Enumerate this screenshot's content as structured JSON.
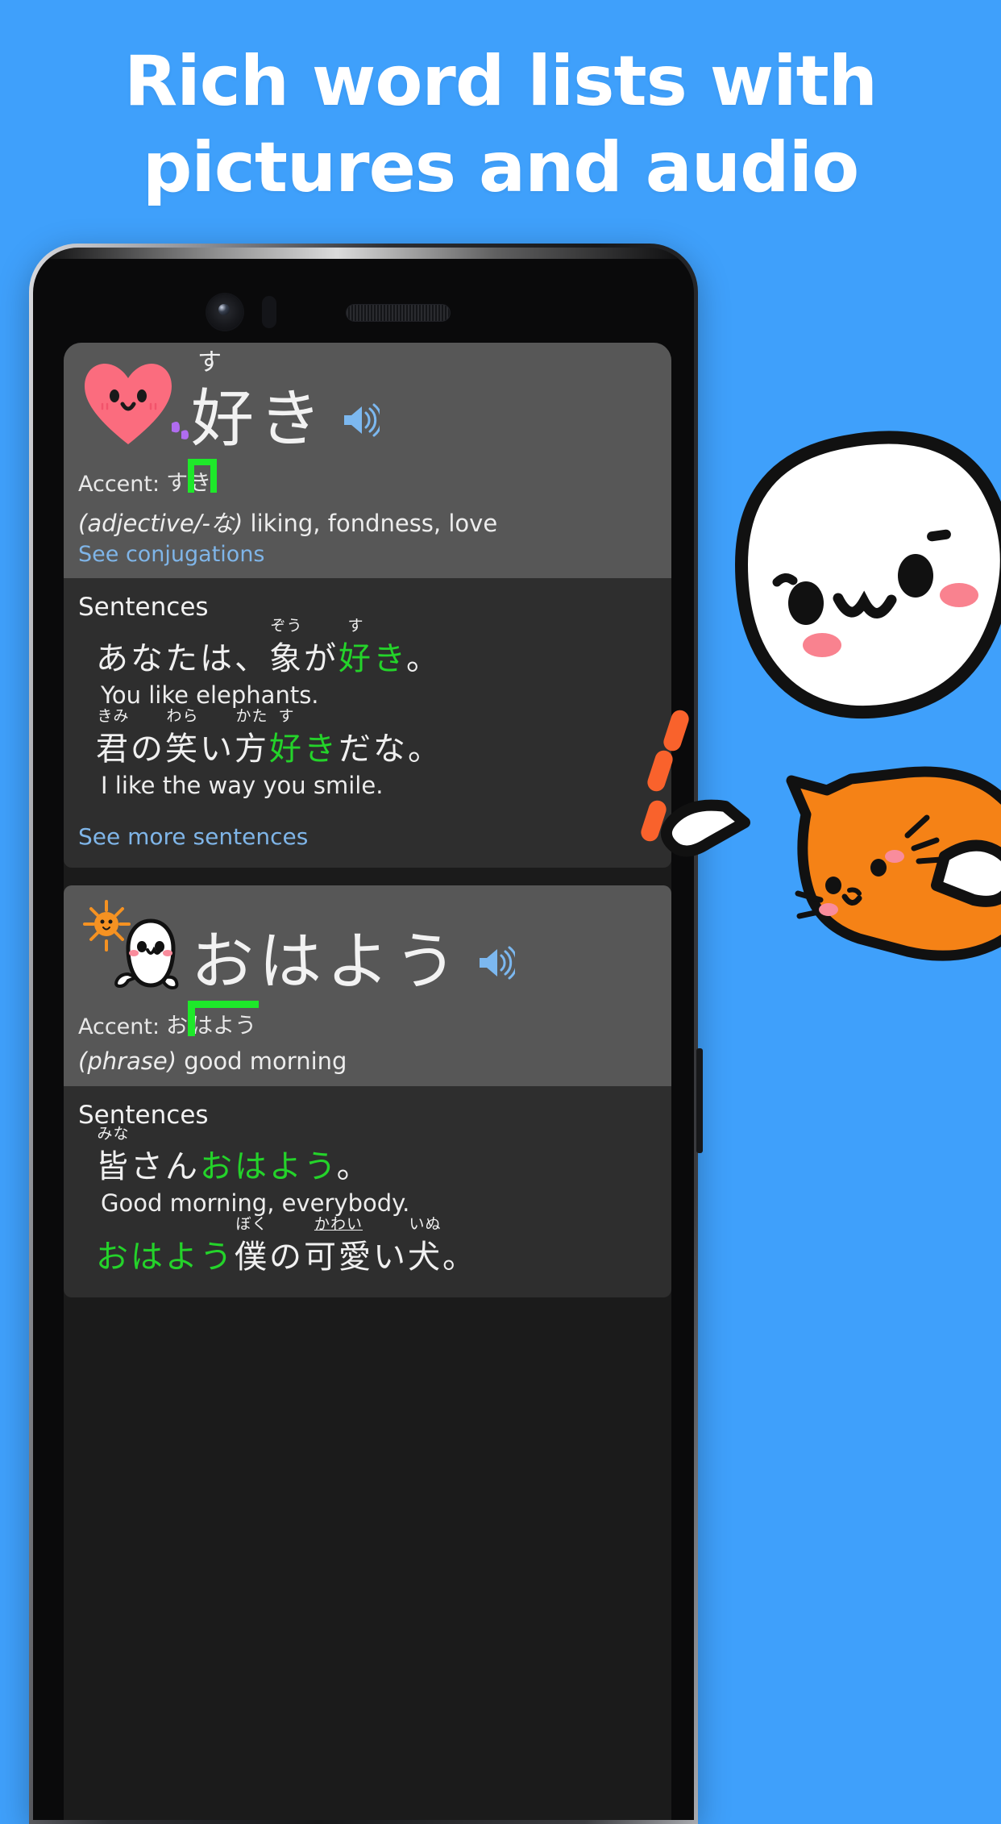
{
  "headline": {
    "line1": "Rich word lists with",
    "line2": "pictures and audio"
  },
  "colors": {
    "background": "#3fa0fb",
    "card_header": "#575757",
    "card_body": "#2e2e2e",
    "accent_green": "#1ee82a",
    "highlight_green": "#24d32a",
    "link_blue": "#7fb5e8",
    "speaker_blue": "#7cb8f0",
    "heart_pink": "#fb6c7e",
    "cat_orange": "#f58216",
    "sun_orange": "#f59222"
  },
  "phone": {
    "camera_icon": "front-camera",
    "sensor_icon": "proximity-sensor",
    "earpiece_icon": "earpiece-speaker"
  },
  "entries": [
    {
      "id": "suki",
      "illustration": "pink-heart-character",
      "word": "好き",
      "furigana": "す",
      "speaker_icon": "speaker-icon",
      "accent_label": "Accent:",
      "accent_kana_flat": "す",
      "accent_kana_high": "き",
      "pos": "(adjective/-な)",
      "definition": "liking, fondness, love",
      "conjugations_link": "See conjugations",
      "sentences_title": "Sentences",
      "sentences": [
        {
          "jp_plain_1": "あなたは、",
          "ruby1_base": "象",
          "ruby1_text": "ぞう",
          "jp_plain_2": "が",
          "ruby2_base": "好",
          "ruby2_text": "す",
          "hl_tail": "き",
          "jp_plain_3": "。",
          "en": "You like elephants."
        },
        {
          "ruby1_base": "君",
          "ruby1_text": "きみ",
          "jp_plain_1": "の",
          "ruby2_base": "笑",
          "ruby2_text": "わら",
          "jp_plain_2": "い",
          "ruby3_base": "方",
          "ruby3_text": "かた",
          "ruby4_base": "好",
          "ruby4_text": "す",
          "hl_tail": "き",
          "jp_plain_3": "だな。",
          "en": "I like the way you smile."
        }
      ],
      "more_sentences_link": "See more sentences"
    },
    {
      "id": "ohayou",
      "illustration": "sun-and-white-blob-character",
      "word": "おはよう",
      "furigana": "",
      "speaker_icon": "speaker-icon",
      "accent_label": "Accent:",
      "accent_kana_flat": "お",
      "accent_kana_high": "はよう",
      "pos": "(phrase)",
      "definition": "good morning",
      "sentences_title": "Sentences",
      "sentences": [
        {
          "ruby1_base": "皆",
          "ruby1_text": "みな",
          "jp_plain_1": "さん",
          "hl_word": "おはよう",
          "jp_plain_3": "。",
          "en": "Good morning, everybody."
        },
        {
          "hl_lead": "おはよう",
          "ruby1_base": "僕",
          "ruby1_text": "ぼく",
          "jp_plain_1": "の",
          "ruby2_base": "可愛",
          "ruby2_text": "かわい",
          "jp_plain_2": "い",
          "ruby3_base": "犬",
          "ruby3_text": "いぬ",
          "jp_plain_3": "。",
          "en": ""
        }
      ]
    }
  ],
  "mascots": {
    "white_blob": "white-blob-mascot",
    "orange_cat": "orange-cat-mascot",
    "speed_lines": "orange-speed-lines"
  }
}
